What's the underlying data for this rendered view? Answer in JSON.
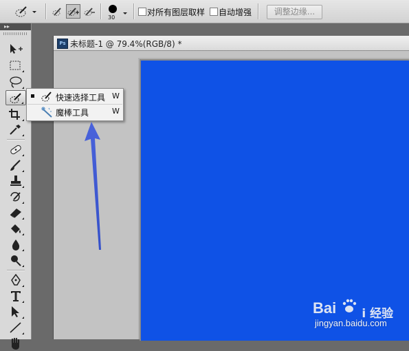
{
  "options_bar": {
    "brush_size": "30",
    "sample_all_layers_label": "对所有图层取样",
    "auto_enhance_label": "自动增强",
    "refine_edge_label": "调整边缘..."
  },
  "tools_panel": {
    "collapse_glyph": "▸▸",
    "tools": [
      {
        "name": "move-tool"
      },
      {
        "name": "rectangular-marquee-tool"
      },
      {
        "name": "lasso-tool"
      },
      {
        "name": "quick-selection-tool",
        "active": true
      },
      {
        "name": "crop-tool"
      },
      {
        "name": "eyedropper-tool"
      },
      {
        "name": "spot-healing-brush-tool"
      },
      {
        "name": "brush-tool"
      },
      {
        "name": "clone-stamp-tool"
      },
      {
        "name": "history-brush-tool"
      },
      {
        "name": "eraser-tool"
      },
      {
        "name": "paint-bucket-tool"
      },
      {
        "name": "blur-tool"
      },
      {
        "name": "dodge-tool"
      },
      {
        "name": "pen-tool"
      },
      {
        "name": "type-tool"
      },
      {
        "name": "path-selection-tool"
      },
      {
        "name": "line-tool"
      },
      {
        "name": "hand-tool"
      }
    ]
  },
  "document": {
    "app_badge": "Ps",
    "title": "未标题-1 @ 79.4%(RGB/8) *",
    "canvas_color": "#0f52e6"
  },
  "flyout": {
    "items": [
      {
        "label": "快速选择工具",
        "shortcut": "W",
        "selected": true
      },
      {
        "label": "魔棒工具",
        "shortcut": "W",
        "selected": false
      }
    ]
  },
  "watermark": {
    "brand_text": "Bai 经验",
    "url": "jingyan.baidu.com"
  },
  "colors": {
    "arrow": "#3d5bd6",
    "canvas": "#0f52e6"
  }
}
